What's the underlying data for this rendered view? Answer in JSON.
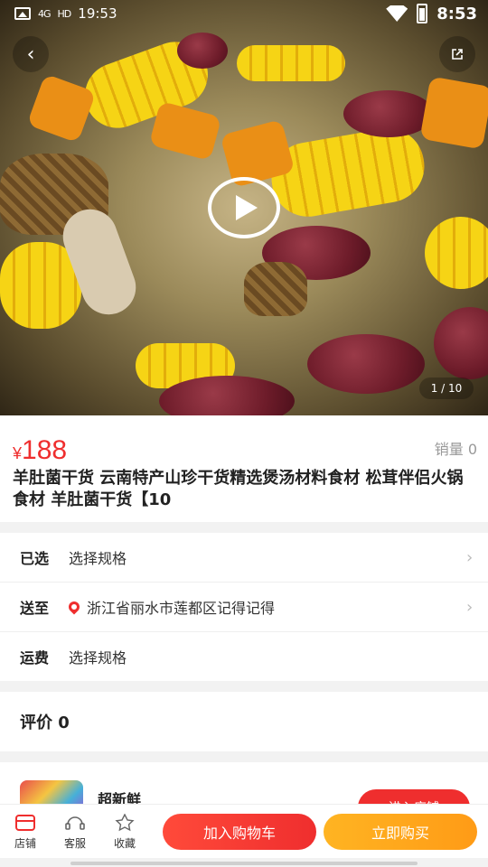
{
  "status_bar": {
    "left_time": "19:53",
    "network": "4G",
    "hd": "HD",
    "right_time": "8:53"
  },
  "media": {
    "pager": "1 / 10"
  },
  "product": {
    "currency": "¥",
    "price": "188",
    "sales_label": "销量",
    "sales_count": "0",
    "title": "羊肚菌干货 云南特产山珍干货精选煲汤材料食材 松茸伴侣火锅食材 羊肚菌干货【10"
  },
  "spec": {
    "selected_label": "已选",
    "selected_value": "选择规格",
    "ship_to_label": "送至",
    "ship_to_value": "浙江省丽水市莲都区记得记得",
    "freight_label": "运费",
    "freight_value": "选择规格"
  },
  "reviews": {
    "label": "评价",
    "count": "0"
  },
  "store": {
    "name": "超新鲜",
    "enter_label": "进入店铺"
  },
  "bottom": {
    "shop": "店铺",
    "service": "客服",
    "favorite": "收藏",
    "add_cart": "加入购物车",
    "buy_now": "立即购买"
  },
  "colors": {
    "accent_red": "#ef2e2e",
    "buy_orange": "#ff9b16"
  }
}
